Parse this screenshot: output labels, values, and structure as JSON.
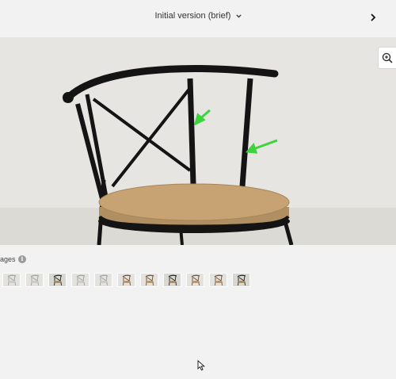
{
  "header": {
    "version_label": "Initial version (brief)",
    "dropdown_icon": "chevron-down-icon",
    "next_icon": "chevron-right-icon"
  },
  "viewer": {
    "zoom_icon": "zoom-in-icon",
    "accent_color": "#3cd43c"
  },
  "gallery": {
    "label": "ages",
    "info_icon": "info-icon",
    "thumbnails": [
      {
        "variant": "white-chair"
      },
      {
        "variant": "white-chair"
      },
      {
        "variant": "dark-chair"
      },
      {
        "variant": "white-chair"
      },
      {
        "variant": "white-chair"
      },
      {
        "variant": "wood-chair"
      },
      {
        "variant": "wood-chair"
      },
      {
        "variant": "dark-chair"
      },
      {
        "variant": "wood-chair"
      },
      {
        "variant": "wood-chair"
      },
      {
        "variant": "dark-chair-selected"
      }
    ]
  }
}
